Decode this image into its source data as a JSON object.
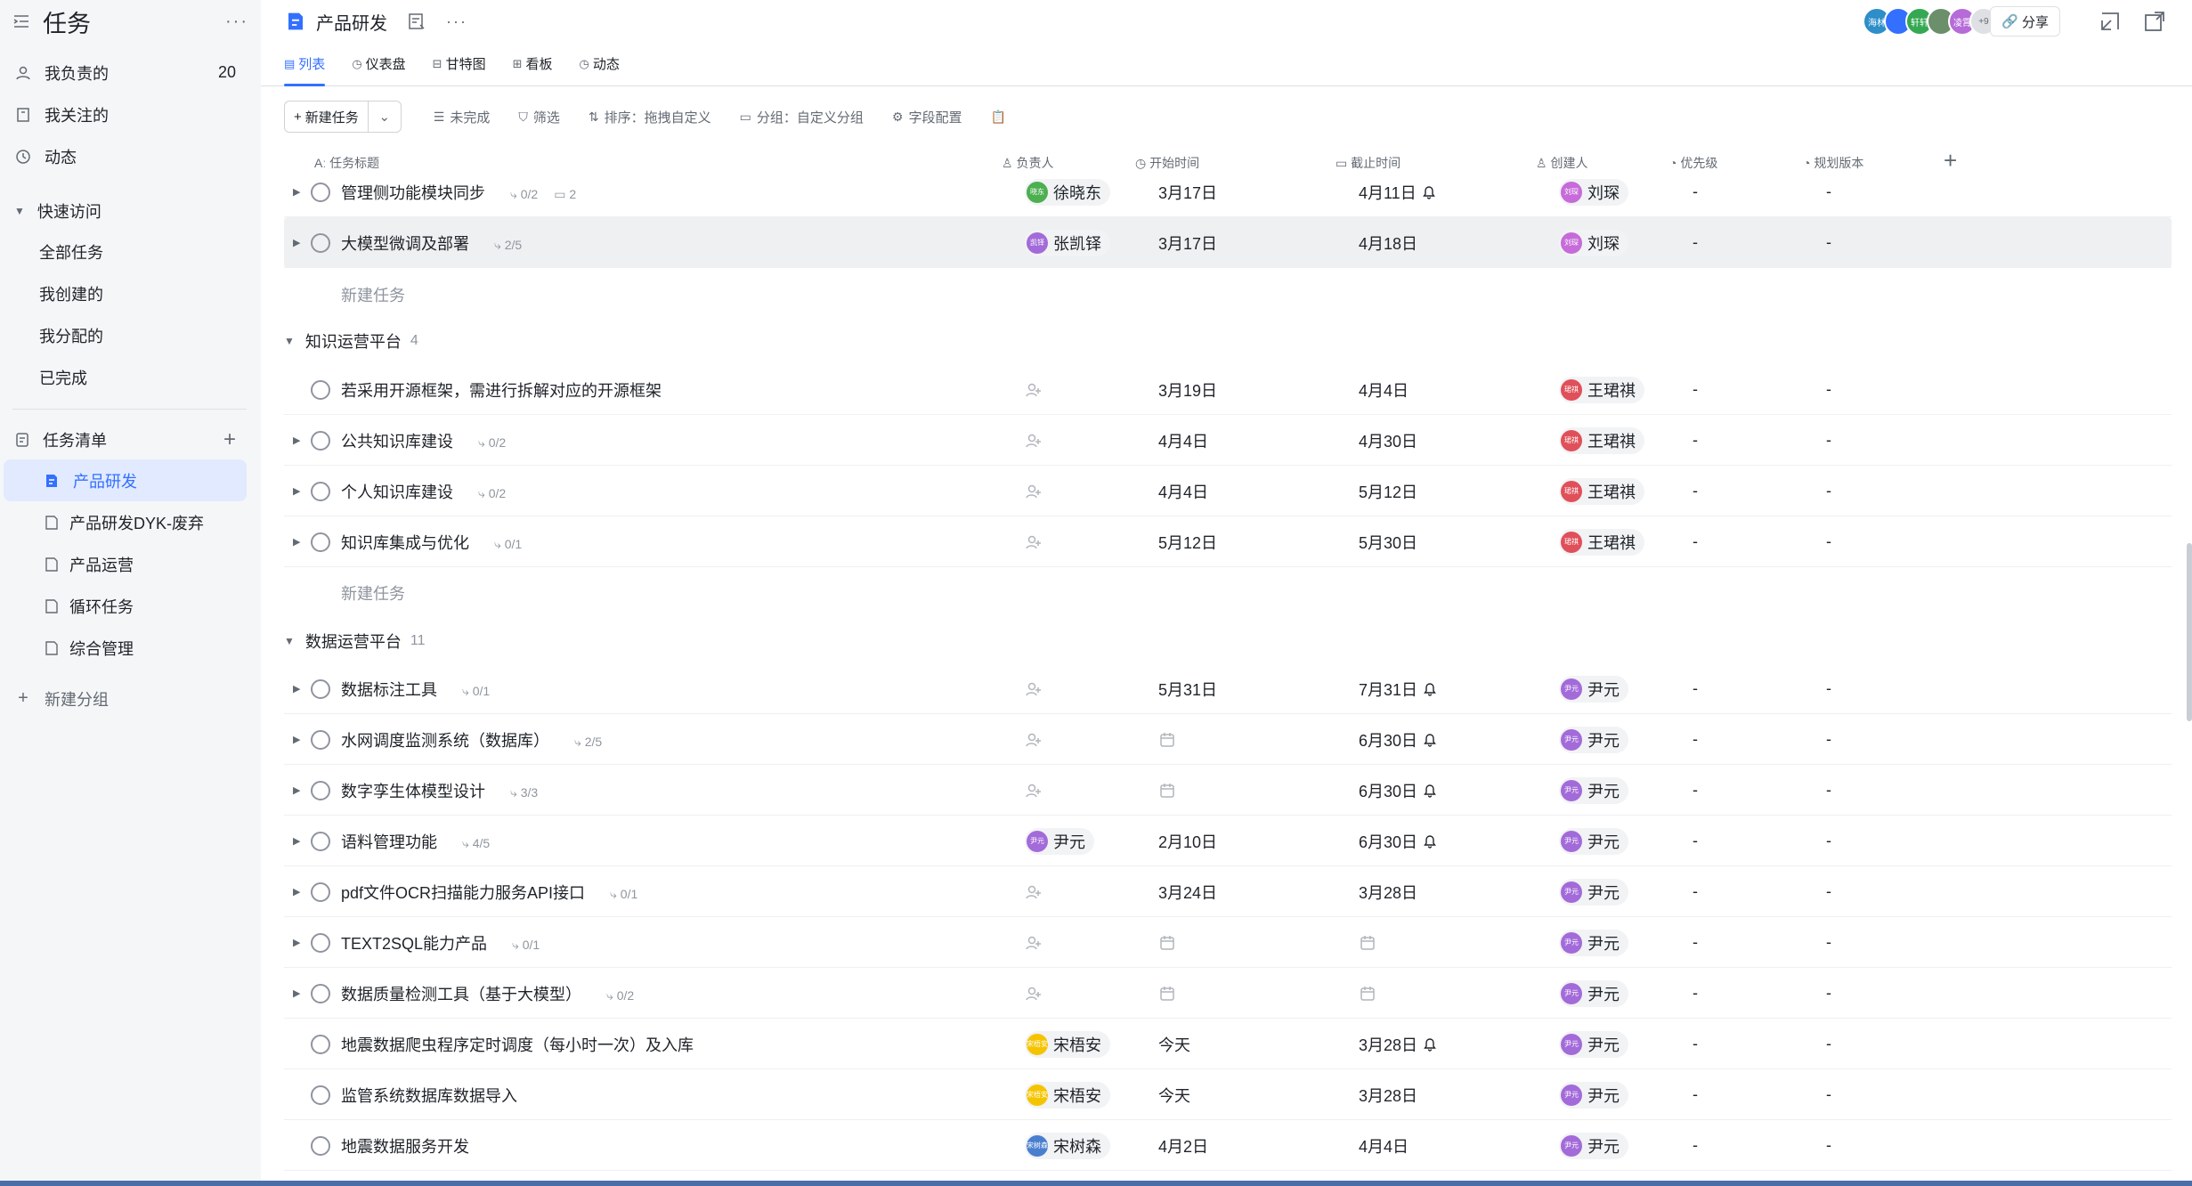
{
  "sidebar": {
    "app_title": "任务",
    "items": [
      {
        "label": "我负责的",
        "count": "20"
      },
      {
        "label": "我关注的"
      },
      {
        "label": "动态"
      }
    ],
    "quick_access": {
      "title": "快速访问",
      "items": [
        "全部任务",
        "我创建的",
        "我分配的",
        "已完成"
      ]
    },
    "task_lists": {
      "title": "任务清单",
      "items": [
        "产品研发",
        "产品研发DYK-废弃",
        "产品运营",
        "循环任务",
        "综合管理"
      ]
    },
    "new_group": "新建分组"
  },
  "header": {
    "project_title": "产品研发",
    "avatars": [
      "海林",
      "",
      "轩轩",
      "",
      "凌霄",
      "+9"
    ],
    "share_label": "分享"
  },
  "tabs": [
    "列表",
    "仪表盘",
    "甘特图",
    "看板",
    "动态"
  ],
  "toolbar": {
    "new_task": "新建任务",
    "incomplete": "未完成",
    "filter": "筛选",
    "sort": "排序：拖拽自定义",
    "group": "分组：自定义分组",
    "fields": "字段配置"
  },
  "columns": [
    "任务标题",
    "负责人",
    "开始时间",
    "截止时间",
    "创建人",
    "优先级",
    "规划版本"
  ],
  "new_task_label": "新建任务",
  "top_rows": [
    {
      "title": "管理侧功能模块同步",
      "sub": "0/2",
      "comments": "2",
      "owner": "徐晓东",
      "owner_tag": "晓东",
      "start": "3月17日",
      "due": "4月11日",
      "creator": "刘琛",
      "priority": "-",
      "version": "-"
    },
    {
      "title": "大模型微调及部署",
      "sub": "2/5",
      "owner": "张凯铎",
      "owner_tag": "凯铎",
      "start": "3月17日",
      "due": "4月18日",
      "creator": "刘琛",
      "priority": "-",
      "version": "-"
    }
  ],
  "group1": {
    "title": "知识运营平台",
    "count": "4",
    "rows": [
      {
        "title": "若采用开源框架，需进行拆解对应的开源框架",
        "sub": "",
        "start": "3月19日",
        "due": "4月4日",
        "creator": "王珺祺",
        "priority": "-",
        "version": "-"
      },
      {
        "title": "公共知识库建设",
        "sub": "0/2",
        "start": "4月4日",
        "due": "4月30日",
        "creator": "王珺祺",
        "priority": "-",
        "version": "-"
      },
      {
        "title": "个人知识库建设",
        "sub": "0/2",
        "start": "4月4日",
        "due": "5月12日",
        "creator": "王珺祺",
        "priority": "-",
        "version": "-"
      },
      {
        "title": "知识库集成与优化",
        "sub": "0/1",
        "start": "5月12日",
        "due": "5月30日",
        "creator": "王珺祺",
        "priority": "-",
        "version": "-"
      }
    ]
  },
  "group2": {
    "title": "数据运营平台",
    "count": "11",
    "rows": [
      {
        "title": "数据标注工具",
        "sub": "0/1",
        "start": "5月31日",
        "due": "7月31日",
        "creator": "尹元",
        "priority": "-",
        "version": "-"
      },
      {
        "title": "水网调度监测系统（数据库）",
        "sub": "2/5",
        "start": "",
        "due": "6月30日",
        "creator": "尹元",
        "priority": "-",
        "version": "-"
      },
      {
        "title": "数字孪生体模型设计",
        "sub": "3/3",
        "start": "",
        "due": "6月30日",
        "creator": "尹元",
        "priority": "-",
        "version": "-"
      },
      {
        "title": "语料管理功能",
        "sub": "4/5",
        "owner": "尹元",
        "start": "2月10日",
        "due": "6月30日",
        "creator": "尹元",
        "priority": "-",
        "version": "-"
      },
      {
        "title": "pdf文件OCR扫描能力服务API接口",
        "sub": "0/1",
        "start": "3月24日",
        "due": "3月28日",
        "creator": "尹元",
        "priority": "-",
        "version": "-"
      },
      {
        "title": "TEXT2SQL能力产品",
        "sub": "0/1",
        "start": "",
        "due": "",
        "creator": "尹元",
        "priority": "-",
        "version": "-"
      },
      {
        "title": "数据质量检测工具（基于大模型）",
        "sub": "0/2",
        "start": "",
        "due": "",
        "creator": "尹元",
        "priority": "-",
        "version": "-"
      },
      {
        "title": "地震数据爬虫程序定时调度（每小时一次）及入库",
        "sub": "",
        "owner": "宋梧安",
        "start": "今天",
        "due": "3月28日",
        "creator": "尹元",
        "priority": "-",
        "version": "-"
      },
      {
        "title": "监管系统数据库数据导入",
        "sub": "",
        "owner": "宋梧安",
        "start": "今天",
        "due": "3月28日",
        "creator": "尹元",
        "priority": "-",
        "version": "-"
      },
      {
        "title": "地震数据服务开发",
        "sub": "",
        "owner": "宋树森",
        "start": "4月2日",
        "due": "4月4日",
        "creator": "尹元",
        "priority": "-",
        "version": "-"
      }
    ]
  },
  "colors": {
    "accent": "#3370ff",
    "sidebar_bg": "#f5f6f7"
  }
}
